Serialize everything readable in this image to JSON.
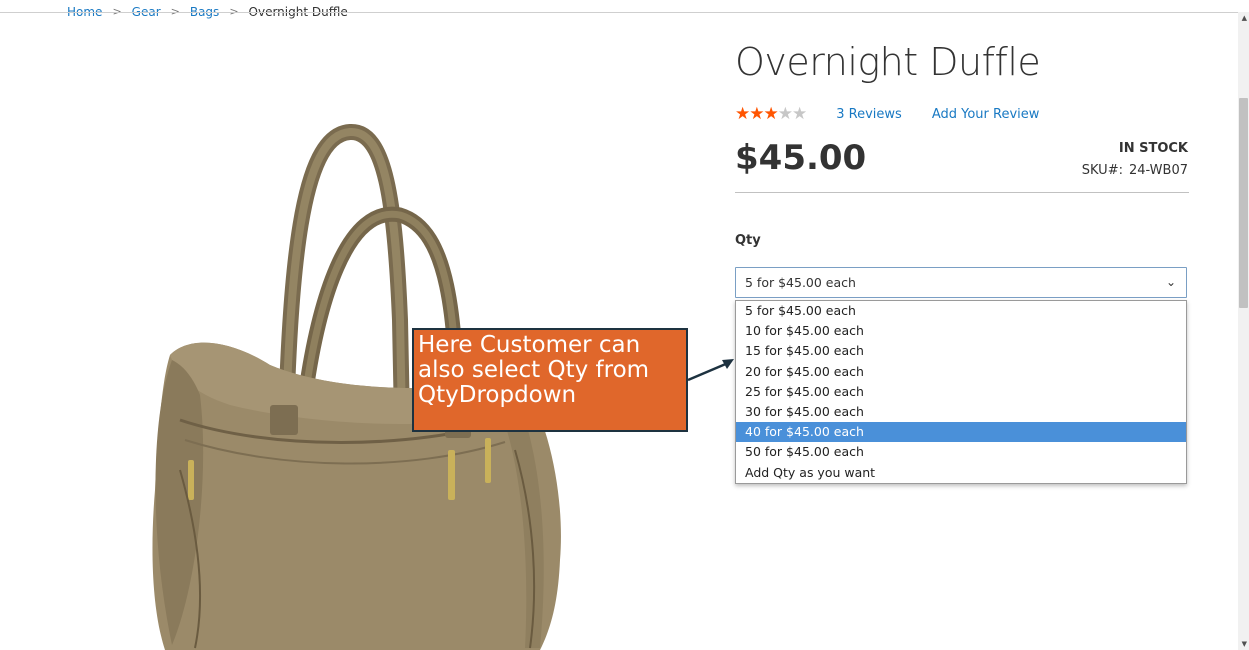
{
  "breadcrumb": {
    "items": [
      "Home",
      "Gear",
      "Bags"
    ],
    "current": "Overnight Duffle",
    "separator": ">"
  },
  "product": {
    "title": "Overnight Duffle",
    "rating_stars": 3,
    "rating_max": 5,
    "reviews_link": "3  Reviews",
    "add_review_link": "Add Your Review",
    "price": "$45.00",
    "stock": "IN STOCK",
    "sku_label": "SKU#:",
    "sku_value": "24-WB07",
    "image_icon": "duffle-bag-image"
  },
  "qty": {
    "label": "Qty",
    "selected_value": "5 for $45.00 each",
    "options": [
      "5 for $45.00 each",
      "10 for $45.00 each",
      "15 for $45.00 each",
      "20 for $45.00 each",
      "25 for $45.00 each",
      "30 for $45.00 each",
      "40 for $45.00 each",
      "50 for $45.00 each",
      "Add Qty as you want"
    ],
    "highlighted_option": "40 for $45.00 each"
  },
  "callout": {
    "lines": [
      "Here Customer can",
      "also select Qty from",
      "QtyDropdown"
    ]
  },
  "colors": {
    "link": "#1979c3",
    "star_on": "#ff5501",
    "star_off": "#c7c7c7",
    "highlight": "#4a90d9",
    "callout_bg": "#e0672b",
    "callout_border": "#1d3240"
  }
}
